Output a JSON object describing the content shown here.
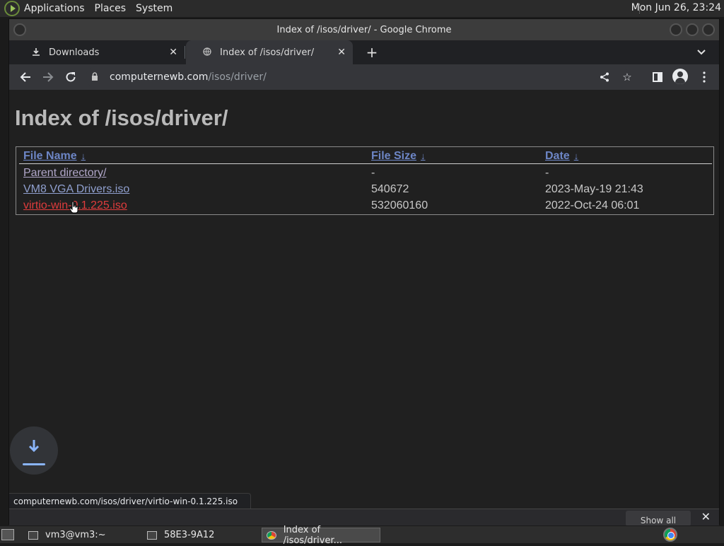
{
  "top_panel": {
    "menus": [
      "Applications",
      "Places",
      "System"
    ],
    "clock": "Mon Jun 26, 23:24"
  },
  "window": {
    "title": "Index of /isos/driver/ - Google Chrome"
  },
  "tabs": [
    {
      "label": "Downloads",
      "icon": "download-icon",
      "active": false
    },
    {
      "label": "Index of /isos/driver/",
      "icon": "globe-icon",
      "active": true
    }
  ],
  "toolbar": {
    "url_host": "computernewb.com",
    "url_path": "/isos/driver/"
  },
  "page": {
    "title": "Index of /isos/driver/",
    "columns": [
      {
        "label": "File Name",
        "arrow": "↓"
      },
      {
        "label": "File Size",
        "arrow": "↓"
      },
      {
        "label": "Date",
        "arrow": "↓"
      }
    ],
    "rows": [
      {
        "name": "Parent directory/",
        "size": "-",
        "date": "-"
      },
      {
        "name": "VM8 VGA Drivers.iso",
        "size": "540672",
        "date": "2023-May-19 21:43"
      },
      {
        "name": "virtio-win-0.1.225.iso",
        "size": "532060160",
        "date": "2022-Oct-24 06:01"
      }
    ]
  },
  "status_bar": {
    "url": "computernewb.com/isos/driver/virtio-win-0.1.225.iso"
  },
  "download_shelf": {
    "show_all": "Show all"
  },
  "taskbar": {
    "items": [
      {
        "label": "vm3@vm3:~"
      },
      {
        "label": "58E3-9A12"
      },
      {
        "label": "Index of /isos/driver..."
      }
    ]
  },
  "colors": {
    "link": "#8f9fce",
    "visited_link": "#b0a6c8",
    "hover_link": "#e03c3c",
    "header_link": "#6d86c6"
  }
}
